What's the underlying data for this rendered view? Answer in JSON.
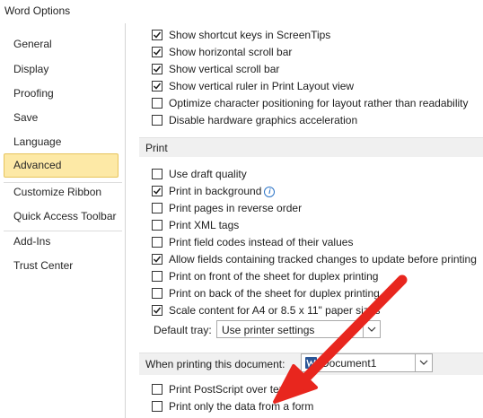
{
  "window": {
    "title": "Word Options"
  },
  "sidebar": {
    "items": [
      {
        "label": "General"
      },
      {
        "label": "Display"
      },
      {
        "label": "Proofing"
      },
      {
        "label": "Save"
      },
      {
        "label": "Language"
      },
      {
        "label": "Advanced"
      },
      {
        "label": "Customize Ribbon"
      },
      {
        "label": "Quick Access Toolbar"
      },
      {
        "label": "Add-Ins"
      },
      {
        "label": "Trust Center"
      }
    ],
    "selected": "Advanced"
  },
  "display_options": [
    {
      "label": "Show shortcut keys in ScreenTips",
      "checked": true
    },
    {
      "label": "Show horizontal scroll bar",
      "checked": true
    },
    {
      "label": "Show vertical scroll bar",
      "checked": true
    },
    {
      "label": "Show vertical ruler in Print Layout view",
      "checked": true
    },
    {
      "label": "Optimize character positioning for layout rather than readability",
      "checked": false
    },
    {
      "label": "Disable hardware graphics acceleration",
      "checked": false
    }
  ],
  "print_section": {
    "heading": "Print",
    "options": [
      {
        "label": "Use draft quality",
        "checked": false
      },
      {
        "label": "Print in background",
        "checked": true
      },
      {
        "label": "Print pages in reverse order",
        "checked": false
      },
      {
        "label": "Print XML tags",
        "checked": false
      },
      {
        "label": "Print field codes instead of their values",
        "checked": false
      },
      {
        "label": "Allow fields containing tracked changes to update before printing",
        "checked": true
      },
      {
        "label": "Print on front of the sheet for duplex printing",
        "checked": false
      },
      {
        "label": "Print on back of the sheet for duplex printing",
        "checked": false
      },
      {
        "label": "Scale content for A4 or 8.5 x 11\" paper sizes",
        "checked": true
      }
    ],
    "default_tray_label": "Default tray:",
    "default_tray_value": "Use printer settings"
  },
  "document_section": {
    "heading": "When printing this document:",
    "document_value": "Document1",
    "options": [
      {
        "label": "Print PostScript over text",
        "checked": false
      },
      {
        "label": "Print only the data from a form",
        "checked": false
      }
    ]
  },
  "icons": {
    "info": "info-icon",
    "document": "word-document-icon",
    "dropdown": "chevron-down-icon",
    "check": "checkmark-icon"
  },
  "colors": {
    "selected_bg": "#fde9a6",
    "selected_border": "#e7c45c",
    "annotation_arrow": "#e8261e",
    "section_bg": "#f0f0f0"
  }
}
